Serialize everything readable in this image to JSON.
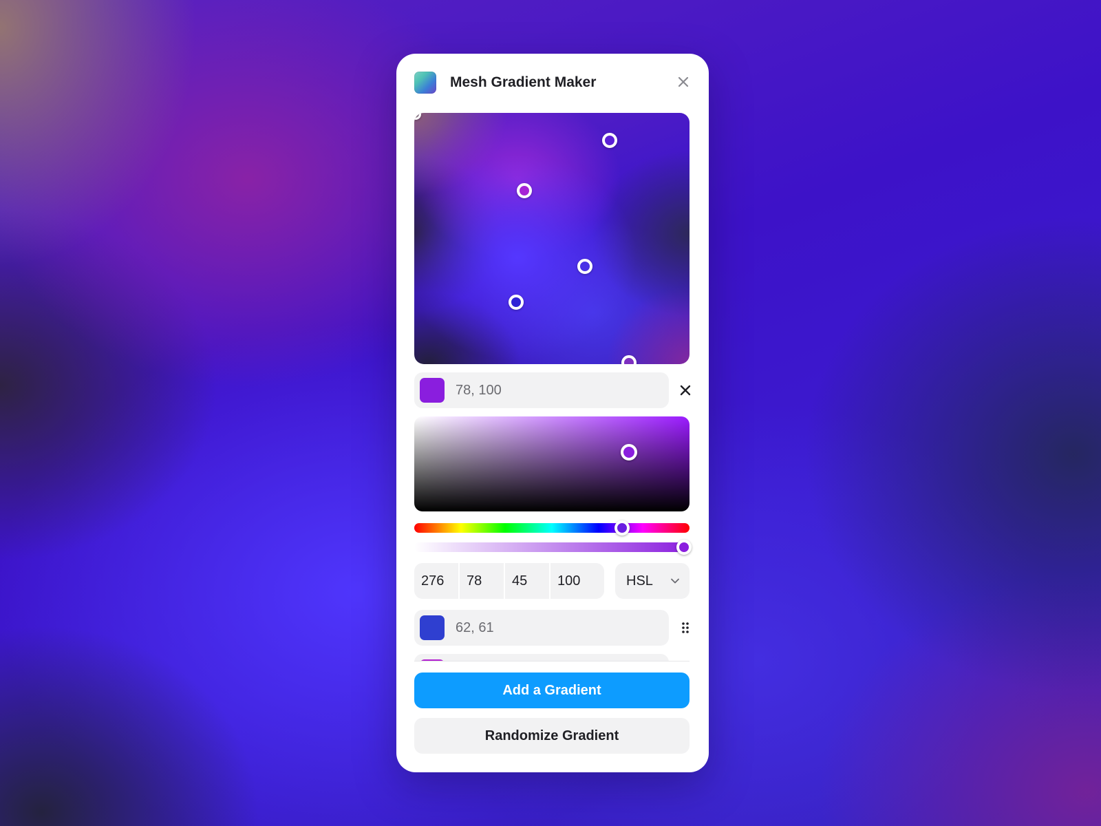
{
  "window": {
    "title": "Mesh Gradient Maker",
    "logo_icon": "gradient-logo-icon",
    "close_icon": "close-icon"
  },
  "mesh": {
    "handles": [
      {
        "name": "mesh-point-1",
        "color": "#8a7a86"
      },
      {
        "name": "mesh-point-2",
        "color": "#5b1fd6"
      },
      {
        "name": "mesh-point-3",
        "color": "#a524d6"
      },
      {
        "name": "mesh-point-4",
        "color": "#4a33e6"
      },
      {
        "name": "mesh-point-5",
        "color": "#2f22d6"
      },
      {
        "name": "mesh-point-6",
        "color": "#7d2fc0"
      }
    ]
  },
  "selected_point": {
    "swatch_color": "#8a1ede",
    "position_text": "78, 100",
    "remove_icon": "close-icon"
  },
  "color_picker": {
    "hue_value": 276,
    "saturation_value": 78,
    "lightness_value": 45,
    "alpha_value": 100,
    "hue_fraction": 0.755,
    "alpha_fraction": 0.98,
    "saturation_fraction": 0.78,
    "value_fraction": 0.62,
    "fields": [
      "276",
      "78",
      "45",
      "100"
    ],
    "mode": "HSL",
    "mode_icon": "chevron-down-icon"
  },
  "other_point": {
    "swatch_color": "#2f3fd0",
    "position_text": "62, 61",
    "drag_icon": "drag-handle-icon"
  },
  "peek_point": {
    "swatch_color": "#b21fd0"
  },
  "actions": {
    "add_label": "Add a Gradient",
    "randomize_label": "Randomize Gradient"
  },
  "colors": {
    "accent": "#0d9cff",
    "panel": "#ffffff",
    "field": "#f2f2f3"
  }
}
